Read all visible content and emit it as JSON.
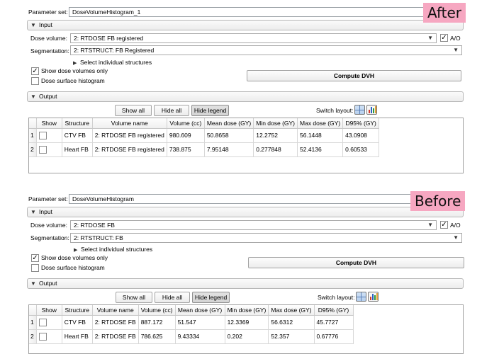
{
  "after": {
    "tag": "After",
    "parameter_set": {
      "label": "Parameter set:",
      "value": "DoseVolumeHistogram_1"
    },
    "input": {
      "title": "Input",
      "dose_volume": {
        "label": "Dose volume:",
        "value": "2: RTDOSE FB registered",
        "checkbox_label": "A/O",
        "checked": true
      },
      "segmentation": {
        "label": "Segmentation:",
        "value": "2: RTSTRUCT: FB Registered"
      },
      "select_structures": "Select individual structures",
      "show_dose_volumes": {
        "label": "Show dose volumes only",
        "checked": true
      },
      "dose_surface": {
        "label": "Dose surface histogram",
        "checked": false
      },
      "compute_button": "Compute DVH"
    },
    "output": {
      "title": "Output",
      "show_all": "Show all",
      "hide_all": "Hide all",
      "hide_legend": "Hide legend",
      "switch_layout": "Switch layout:",
      "table": {
        "headers": [
          "Show",
          "Structure",
          "Volume name",
          "Volume (cc)",
          "Mean dose (GY)",
          "Min dose (GY)",
          "Max dose (GY)",
          "D95% (GY)"
        ],
        "rows": [
          {
            "index": "1",
            "structure": "CTV FB",
            "volume_name": "2: RTDOSE FB registered",
            "volume_cc": "980.609",
            "mean": "50.8658",
            "min": "12.2752",
            "max": "56.1448",
            "d95": "43.0908"
          },
          {
            "index": "2",
            "structure": "Heart FB",
            "volume_name": "2: RTDOSE FB registered",
            "volume_cc": "738.875",
            "mean": "7.95148",
            "min": "0.277848",
            "max": "52.4136",
            "d95": "0.60533"
          }
        ]
      }
    }
  },
  "before": {
    "tag": "Before",
    "parameter_set": {
      "label": "Parameter set:",
      "value": "DoseVolumeHistogram"
    },
    "input": {
      "title": "Input",
      "dose_volume": {
        "label": "Dose volume:",
        "value": "2: RTDOSE FB",
        "checkbox_label": "A/O",
        "checked": true
      },
      "segmentation": {
        "label": "Segmentation:",
        "value": "2: RTSTRUCT: FB"
      },
      "select_structures": "Select individual structures",
      "show_dose_volumes": {
        "label": "Show dose volumes only",
        "checked": true
      },
      "dose_surface": {
        "label": "Dose surface histogram",
        "checked": false
      },
      "compute_button": "Compute DVH"
    },
    "output": {
      "title": "Output",
      "show_all": "Show all",
      "hide_all": "Hide all",
      "hide_legend": "Hide legend",
      "switch_layout": "Switch layout:",
      "table": {
        "headers": [
          "Show",
          "Structure",
          "Volume name",
          "Volume (cc)",
          "Mean dose (GY)",
          "Min dose (GY)",
          "Max dose (GY)",
          "D95% (GY)"
        ],
        "rows": [
          {
            "index": "1",
            "structure": "CTV FB",
            "volume_name": "2: RTDOSE FB",
            "volume_cc": "887.172",
            "mean": "51.547",
            "min": "12.3369",
            "max": "56.6312",
            "d95": "45.7727"
          },
          {
            "index": "2",
            "structure": "Heart FB",
            "volume_name": "2: RTDOSE FB",
            "volume_cc": "786.625",
            "mean": "9.43334",
            "min": "0.202",
            "max": "52.357",
            "d95": "0.67776"
          }
        ]
      }
    }
  },
  "icons": {
    "section_caret": "caret-down-icon",
    "expander": "caret-right-icon",
    "combo_arrow": "chevron-down-icon",
    "layout_grid": "four-up-layout-icon",
    "layout_chart": "chart-layout-icon"
  },
  "colors": {
    "tag_background": "#f6a7c1",
    "chart_bars": [
      "#d23a2c",
      "#2c62c2",
      "#2f9a3a",
      "#e6a23c"
    ]
  }
}
